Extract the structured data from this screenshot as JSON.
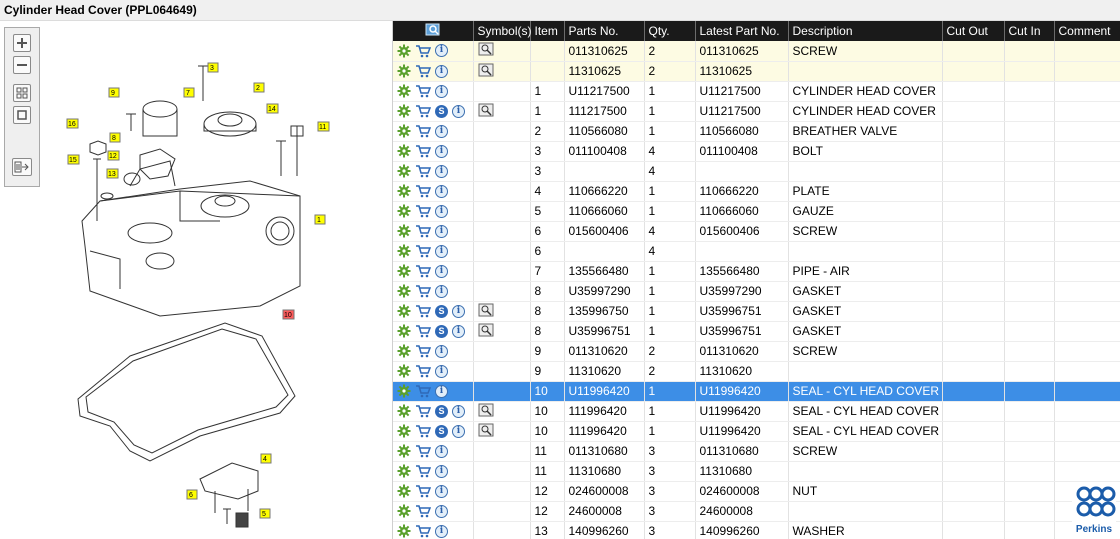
{
  "title": "Cylinder Head Cover (PPL064649)",
  "columns": {
    "search": "",
    "symbols": "Symbol(s)",
    "item": "Item",
    "parts_no": "Parts No.",
    "qty": "Qty.",
    "latest_part_no": "Latest Part No.",
    "description": "Description",
    "cut_out": "Cut Out",
    "cut_in": "Cut In",
    "comment": "Comment"
  },
  "rows": [
    {
      "item": "",
      "parts_no": "011310625",
      "qty": "2",
      "latest": "011310625",
      "desc": "SCREW",
      "s_icon": false,
      "sym": true,
      "state": "highlight"
    },
    {
      "item": "",
      "parts_no": "11310625",
      "qty": "2",
      "latest": "11310625",
      "desc": "",
      "s_icon": false,
      "sym": true,
      "state": "highlight"
    },
    {
      "item": "1",
      "parts_no": "U11217500",
      "qty": "1",
      "latest": "U11217500",
      "desc": "CYLINDER HEAD COVER",
      "s_icon": false,
      "sym": false,
      "state": "normal"
    },
    {
      "item": "1",
      "parts_no": "111217500",
      "qty": "1",
      "latest": "U11217500",
      "desc": "CYLINDER HEAD COVER",
      "s_icon": true,
      "sym": true,
      "state": "normal"
    },
    {
      "item": "2",
      "parts_no": "110566080",
      "qty": "1",
      "latest": "110566080",
      "desc": "BREATHER VALVE",
      "s_icon": false,
      "sym": false,
      "state": "normal"
    },
    {
      "item": "3",
      "parts_no": "011100408",
      "qty": "4",
      "latest": "011100408",
      "desc": "BOLT",
      "s_icon": false,
      "sym": false,
      "state": "normal"
    },
    {
      "item": "3",
      "parts_no": "",
      "qty": "4",
      "latest": "",
      "desc": "",
      "s_icon": false,
      "sym": false,
      "state": "normal"
    },
    {
      "item": "4",
      "parts_no": "110666220",
      "qty": "1",
      "latest": "110666220",
      "desc": "PLATE",
      "s_icon": false,
      "sym": false,
      "state": "normal"
    },
    {
      "item": "5",
      "parts_no": "110666060",
      "qty": "1",
      "latest": "110666060",
      "desc": "GAUZE",
      "s_icon": false,
      "sym": false,
      "state": "normal"
    },
    {
      "item": "6",
      "parts_no": "015600406",
      "qty": "4",
      "latest": "015600406",
      "desc": "SCREW",
      "s_icon": false,
      "sym": false,
      "state": "normal"
    },
    {
      "item": "6",
      "parts_no": "",
      "qty": "4",
      "latest": "",
      "desc": "",
      "s_icon": false,
      "sym": false,
      "state": "normal"
    },
    {
      "item": "7",
      "parts_no": "135566480",
      "qty": "1",
      "latest": "135566480",
      "desc": "PIPE - AIR",
      "s_icon": false,
      "sym": false,
      "state": "normal"
    },
    {
      "item": "8",
      "parts_no": "U35997290",
      "qty": "1",
      "latest": "U35997290",
      "desc": "GASKET",
      "s_icon": false,
      "sym": false,
      "state": "normal"
    },
    {
      "item": "8",
      "parts_no": "135996750",
      "qty": "1",
      "latest": "U35996751",
      "desc": "GASKET",
      "s_icon": true,
      "sym": true,
      "state": "normal"
    },
    {
      "item": "8",
      "parts_no": "U35996751",
      "qty": "1",
      "latest": "U35996751",
      "desc": "GASKET",
      "s_icon": true,
      "sym": true,
      "state": "normal"
    },
    {
      "item": "9",
      "parts_no": "011310620",
      "qty": "2",
      "latest": "011310620",
      "desc": "SCREW",
      "s_icon": false,
      "sym": false,
      "state": "normal"
    },
    {
      "item": "9",
      "parts_no": "11310620",
      "qty": "2",
      "latest": "11310620",
      "desc": "",
      "s_icon": false,
      "sym": false,
      "state": "normal"
    },
    {
      "item": "10",
      "parts_no": "U11996420",
      "qty": "1",
      "latest": "U11996420",
      "desc": "SEAL - CYL HEAD COVER",
      "s_icon": false,
      "sym": false,
      "state": "selected"
    },
    {
      "item": "10",
      "parts_no": "111996420",
      "qty": "1",
      "latest": "U11996420",
      "desc": "SEAL - CYL HEAD COVER",
      "s_icon": true,
      "sym": true,
      "state": "normal"
    },
    {
      "item": "10",
      "parts_no": "111996420",
      "qty": "1",
      "latest": "U11996420",
      "desc": "SEAL - CYL HEAD COVER",
      "s_icon": true,
      "sym": true,
      "state": "normal"
    },
    {
      "item": "11",
      "parts_no": "011310680",
      "qty": "3",
      "latest": "011310680",
      "desc": "SCREW",
      "s_icon": false,
      "sym": false,
      "state": "normal"
    },
    {
      "item": "11",
      "parts_no": "11310680",
      "qty": "3",
      "latest": "11310680",
      "desc": "",
      "s_icon": false,
      "sym": false,
      "state": "normal"
    },
    {
      "item": "12",
      "parts_no": "024600008",
      "qty": "3",
      "latest": "024600008",
      "desc": "NUT",
      "s_icon": false,
      "sym": false,
      "state": "normal"
    },
    {
      "item": "12",
      "parts_no": "24600008",
      "qty": "3",
      "latest": "24600008",
      "desc": "",
      "s_icon": false,
      "sym": false,
      "state": "normal"
    },
    {
      "item": "13",
      "parts_no": "140996260",
      "qty": "3",
      "latest": "140996260",
      "desc": "WASHER",
      "s_icon": false,
      "sym": false,
      "state": "normal"
    }
  ],
  "diagram": {
    "callouts": [
      "1",
      "2",
      "3",
      "4",
      "5",
      "6",
      "7",
      "8",
      "9",
      "10",
      "11",
      "12",
      "13",
      "14",
      "15",
      "16"
    ]
  },
  "logo": {
    "text": "Perkins",
    "color": "#1b5caa"
  },
  "colors": {
    "header_bg": "#1a1a1a",
    "selected_row": "#3d8ee6",
    "highlight_row": "#fdfbe3",
    "callout_yellow": "#ffff00",
    "callout_red": "#ff5b5b"
  }
}
